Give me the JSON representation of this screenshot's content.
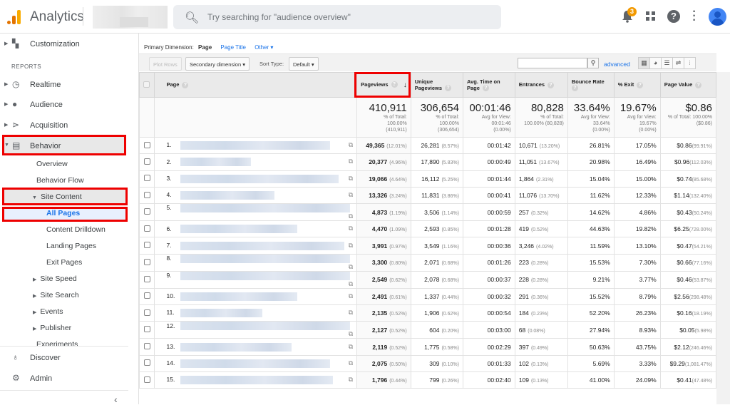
{
  "header": {
    "app_title": "Analytics",
    "search_placeholder": "Try searching for \"audience overview\"",
    "notification_count": "3",
    "help_glyph": "?",
    "icons": [
      "analytics-logo-icon",
      "search-icon",
      "bell-icon",
      "apps-grid-icon",
      "help-icon",
      "more-vert-icon",
      "account-avatar-icon"
    ]
  },
  "sidebar": {
    "customization": "Customization",
    "reports_heading": "REPORTS",
    "items": [
      {
        "label": "Realtime",
        "icon": "clock-icon"
      },
      {
        "label": "Audience",
        "icon": "person-icon"
      },
      {
        "label": "Acquisition",
        "icon": "acquisition-icon"
      },
      {
        "label": "Behavior",
        "icon": "behavior-icon"
      }
    ],
    "behavior_sub": {
      "overview": "Overview",
      "behavior_flow": "Behavior Flow",
      "site_content": "Site Content",
      "all_pages": "All Pages",
      "content_drilldown": "Content Drilldown",
      "landing_pages": "Landing Pages",
      "exit_pages": "Exit Pages",
      "site_speed": "Site Speed",
      "site_search": "Site Search",
      "events": "Events",
      "publisher": "Publisher",
      "experiments": "Experiments"
    },
    "discover": "Discover",
    "admin": "Admin",
    "collapse_glyph": "‹"
  },
  "report": {
    "primary_dimension_label": "Primary Dimension:",
    "primary_dimension_active": "Page",
    "dimension_links": [
      "Page Title",
      "Other ▾"
    ],
    "plot_rows": "Plot Rows",
    "secondary_dimension": "Secondary dimension ▾",
    "sort_type_label": "Sort Type:",
    "sort_type_value": "Default ▾",
    "search_value": "",
    "advanced": "advanced",
    "view_icons": [
      "table-view-icon",
      "pie-view-icon",
      "performance-view-icon",
      "comparison-view-icon",
      "pivot-view-icon"
    ]
  },
  "table": {
    "columns": [
      "Page",
      "Pageviews",
      "Unique Pageviews",
      "Avg. Time on Page",
      "Entrances",
      "Bounce Rate",
      "% Exit",
      "Page Value"
    ],
    "sort_indicator": "↓",
    "totals": [
      {
        "value": "410,911",
        "lines": [
          "% of Total:",
          "100.00%",
          "(410,911)"
        ]
      },
      {
        "value": "306,654",
        "lines": [
          "% of Total:",
          "100.00%",
          "(306,654)"
        ]
      },
      {
        "value": "00:01:46",
        "lines": [
          "Avg for View:",
          "00:01:46",
          "(0.00%)"
        ]
      },
      {
        "value": "80,828",
        "lines": [
          "% of Total:",
          "100.00% (80,828)"
        ]
      },
      {
        "value": "33.64%",
        "lines": [
          "Avg for View:",
          "33.64%",
          "(0.00%)"
        ]
      },
      {
        "value": "19.67%",
        "lines": [
          "Avg for View:",
          "19.67%",
          "(0.00%)"
        ]
      },
      {
        "value": "$0.86",
        "lines": [
          "% of Total: 100.00%",
          "($0.86)"
        ]
      }
    ],
    "rows": [
      {
        "n": "1.",
        "pv": "49,365",
        "pvp": "(12.01%)",
        "upv": "26,281",
        "upvp": "(8.57%)",
        "atp": "00:01:42",
        "ent": "10,671",
        "entp": "(13.20%)",
        "br": "26.81%",
        "ex": "17.05%",
        "val": "$0.86",
        "valp": "(99.91%)"
      },
      {
        "n": "2.",
        "pv": "20,377",
        "pvp": "(4.96%)",
        "upv": "17,890",
        "upvp": "(5.83%)",
        "atp": "00:00:49",
        "ent": "11,051",
        "entp": "(13.67%)",
        "br": "20.98%",
        "ex": "16.49%",
        "val": "$0.96",
        "valp": "(112.03%)"
      },
      {
        "n": "3.",
        "pv": "19,066",
        "pvp": "(4.64%)",
        "upv": "16,112",
        "upvp": "(5.25%)",
        "atp": "00:01:44",
        "ent": "1,864",
        "entp": "(2.31%)",
        "br": "15.04%",
        "ex": "15.00%",
        "val": "$0.74",
        "valp": "(85.68%)"
      },
      {
        "n": "4.",
        "pv": "13,326",
        "pvp": "(3.24%)",
        "upv": "11,831",
        "upvp": "(3.86%)",
        "atp": "00:00:41",
        "ent": "11,076",
        "entp": "(13.70%)",
        "br": "11.62%",
        "ex": "12.33%",
        "val": "$1.14",
        "valp": "(132.40%)"
      },
      {
        "n": "5.",
        "pv": "4,873",
        "pvp": "(1.19%)",
        "upv": "3,506",
        "upvp": "(1.14%)",
        "atp": "00:00:59",
        "ent": "257",
        "entp": "(0.32%)",
        "br": "14.62%",
        "ex": "4.86%",
        "val": "$0.43",
        "valp": "(50.24%)"
      },
      {
        "n": "6.",
        "pv": "4,470",
        "pvp": "(1.09%)",
        "upv": "2,593",
        "upvp": "(0.85%)",
        "atp": "00:01:28",
        "ent": "419",
        "entp": "(0.52%)",
        "br": "44.63%",
        "ex": "19.82%",
        "val": "$6.25",
        "valp": "(728.00%)"
      },
      {
        "n": "7.",
        "pv": "3,991",
        "pvp": "(0.97%)",
        "upv": "3,549",
        "upvp": "(1.16%)",
        "atp": "00:00:36",
        "ent": "3,246",
        "entp": "(4.02%)",
        "br": "11.59%",
        "ex": "13.10%",
        "val": "$0.47",
        "valp": "(54.21%)"
      },
      {
        "n": "8.",
        "pv": "3,300",
        "pvp": "(0.80%)",
        "upv": "2,071",
        "upvp": "(0.68%)",
        "atp": "00:01:26",
        "ent": "223",
        "entp": "(0.28%)",
        "br": "15.53%",
        "ex": "7.30%",
        "val": "$0.66",
        "valp": "(77.16%)"
      },
      {
        "n": "9.",
        "pv": "2,549",
        "pvp": "(0.62%)",
        "upv": "2,078",
        "upvp": "(0.68%)",
        "atp": "00:00:37",
        "ent": "228",
        "entp": "(0.28%)",
        "br": "9.21%",
        "ex": "3.77%",
        "val": "$0.46",
        "valp": "(53.87%)"
      },
      {
        "n": "10.",
        "pv": "2,491",
        "pvp": "(0.61%)",
        "upv": "1,337",
        "upvp": "(0.44%)",
        "atp": "00:00:32",
        "ent": "291",
        "entp": "(0.36%)",
        "br": "15.52%",
        "ex": "8.79%",
        "val": "$2.56",
        "valp": "(298.48%)"
      },
      {
        "n": "11.",
        "pv": "2,135",
        "pvp": "(0.52%)",
        "upv": "1,906",
        "upvp": "(0.62%)",
        "atp": "00:00:54",
        "ent": "184",
        "entp": "(0.23%)",
        "br": "52.20%",
        "ex": "26.23%",
        "val": "$0.16",
        "valp": "(18.19%)"
      },
      {
        "n": "12.",
        "pv": "2,127",
        "pvp": "(0.52%)",
        "upv": "604",
        "upvp": "(0.20%)",
        "atp": "00:03:00",
        "ent": "68",
        "entp": "(0.08%)",
        "br": "27.94%",
        "ex": "8.93%",
        "val": "$0.05",
        "valp": "(5.98%)"
      },
      {
        "n": "13.",
        "pv": "2,119",
        "pvp": "(0.52%)",
        "upv": "1,775",
        "upvp": "(0.58%)",
        "atp": "00:02:29",
        "ent": "397",
        "entp": "(0.49%)",
        "br": "50.63%",
        "ex": "43.75%",
        "val": "$2.12",
        "valp": "(246.46%)"
      },
      {
        "n": "14.",
        "pv": "2,075",
        "pvp": "(0.50%)",
        "upv": "309",
        "upvp": "(0.10%)",
        "atp": "00:01:33",
        "ent": "102",
        "entp": "(0.13%)",
        "br": "5.69%",
        "ex": "3.33%",
        "val": "$9.29",
        "valp": "(1,081.47%)"
      },
      {
        "n": "15.",
        "pv": "1,796",
        "pvp": "(0.44%)",
        "upv": "799",
        "upvp": "(0.26%)",
        "atp": "00:02:40",
        "ent": "109",
        "entp": "(0.13%)",
        "br": "41.00%",
        "ex": "24.09%",
        "val": "$0.41",
        "valp": "(47.48%)"
      }
    ]
  }
}
